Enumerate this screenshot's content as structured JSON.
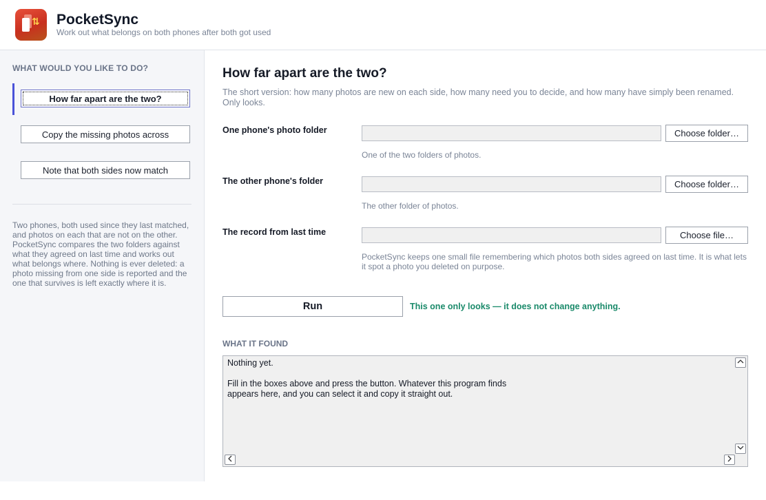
{
  "app": {
    "title": "PocketSync",
    "subtitle": "Work out what belongs on both phones after both got used"
  },
  "sidebar": {
    "heading": "WHAT WOULD YOU LIKE TO DO?",
    "items": [
      {
        "label": "How far apart are the two?",
        "active": true
      },
      {
        "label": "Copy the missing photos across",
        "active": false
      },
      {
        "label": "Note that both sides now match",
        "active": false
      }
    ],
    "description": "Two phones, both used since they last matched, and photos on each that are not on the other. PocketSync compares the two folders against what they agreed on last time and works out what belongs where. Nothing is ever deleted: a photo missing from one side is reported and the one that survives is left exactly where it is."
  },
  "main": {
    "title": "How far apart are the two?",
    "intro": "The short version: how many photos are new on each side, how many need you to decide, and how many have simply been renamed. Only looks.",
    "fields": [
      {
        "label": "One phone's photo folder",
        "value": "",
        "button": "Choose folder…",
        "help": "One of the two folders of photos."
      },
      {
        "label": "The other phone's folder",
        "value": "",
        "button": "Choose folder…",
        "help": "The other folder of photos."
      },
      {
        "label": "The record from last time",
        "value": "",
        "button": "Choose file…",
        "help": "PocketSync keeps one small file remembering which photos both sides agreed on last time. It is what lets it spot a photo you deleted on purpose."
      }
    ],
    "run_label": "Run",
    "run_note": "This one only looks — it does not change anything.",
    "found_heading": "WHAT IT FOUND",
    "output_text": "Nothing yet.\n\nFill in the boxes above and press the button. Whatever this program finds\nappears here, and you can select it and copy it straight out."
  },
  "icons": {
    "logo": "phone-sync-icon",
    "scroll_up": "chevron-up-icon",
    "scroll_down": "chevron-down-icon",
    "scroll_left": "chevron-left-icon",
    "scroll_right": "chevron-right-icon"
  },
  "colors": {
    "accent": "#4a52d8",
    "note_green": "#1a8a6a",
    "logo_red": "#d9402a"
  }
}
